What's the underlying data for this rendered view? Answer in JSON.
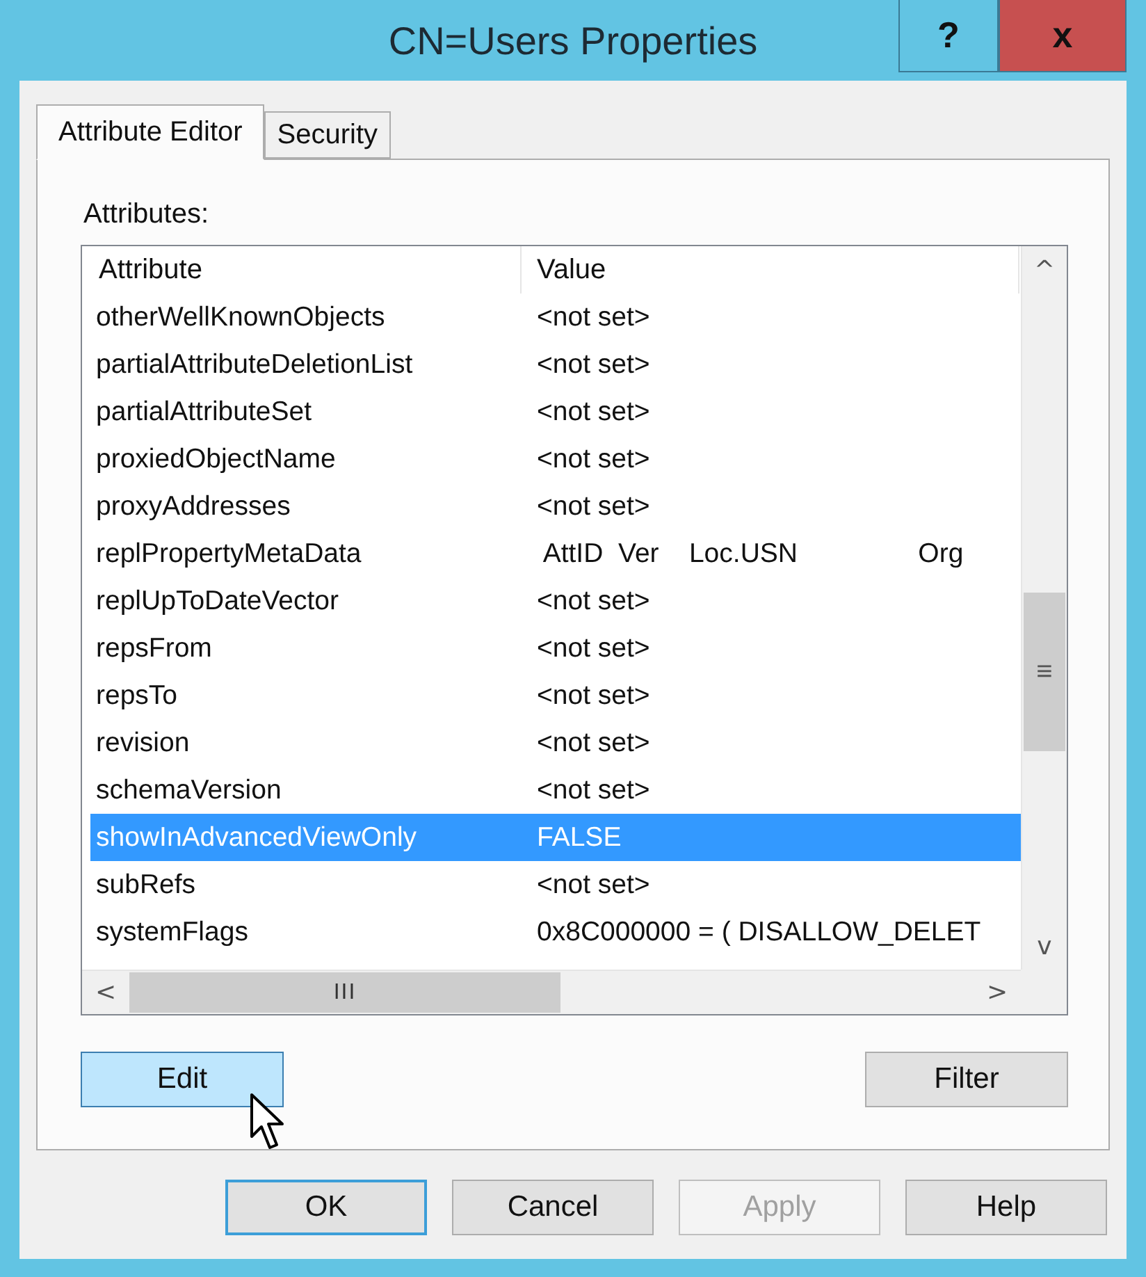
{
  "window": {
    "title": "CN=Users Properties",
    "buttons": [
      {
        "kind": "help",
        "label": "?"
      },
      {
        "kind": "close",
        "label": "x"
      }
    ]
  },
  "tabs": [
    {
      "label": "Attribute Editor",
      "selected": true
    },
    {
      "label": "Security",
      "selected": false
    }
  ],
  "attributes_label": "Attributes:",
  "table": {
    "columns": [
      "Attribute",
      "Value"
    ],
    "rows": [
      {
        "attribute": "otherWellKnownObjects",
        "value": "<not set>",
        "selected": false
      },
      {
        "attribute": "partialAttributeDeletionList",
        "value": "<not set>",
        "selected": false
      },
      {
        "attribute": "partialAttributeSet",
        "value": "<not set>",
        "selected": false
      },
      {
        "attribute": "proxiedObjectName",
        "value": "<not set>",
        "selected": false
      },
      {
        "attribute": "proxyAddresses",
        "value": "<not set>",
        "selected": false
      },
      {
        "attribute": "replPropertyMetaData",
        "value": " AttID  Ver    Loc.USN                Org",
        "selected": false
      },
      {
        "attribute": "replUpToDateVector",
        "value": "<not set>",
        "selected": false
      },
      {
        "attribute": "repsFrom",
        "value": "<not set>",
        "selected": false
      },
      {
        "attribute": "repsTo",
        "value": "<not set>",
        "selected": false
      },
      {
        "attribute": "revision",
        "value": "<not set>",
        "selected": false
      },
      {
        "attribute": "schemaVersion",
        "value": "<not set>",
        "selected": false
      },
      {
        "attribute": "showInAdvancedViewOnly",
        "value": "FALSE",
        "selected": true
      },
      {
        "attribute": "subRefs",
        "value": "<not set>",
        "selected": false
      },
      {
        "attribute": "systemFlags",
        "value": "0x8C000000 = ( DISALLOW_DELET",
        "selected": false
      }
    ],
    "scroll_glyphs": {
      "up": "^",
      "grip": "≡",
      "down": "v",
      "left": "<",
      "hgrip": "III",
      "right": ">"
    }
  },
  "panel_buttons": [
    {
      "label": "Edit",
      "hovered": true
    },
    {
      "label": "Filter",
      "hovered": false
    }
  ],
  "footer_buttons": [
    {
      "label": "OK",
      "default": true,
      "disabled": false
    },
    {
      "label": "Cancel",
      "default": false,
      "disabled": false
    },
    {
      "label": "Apply",
      "default": false,
      "disabled": true
    },
    {
      "label": "Help",
      "default": false,
      "disabled": false
    }
  ]
}
